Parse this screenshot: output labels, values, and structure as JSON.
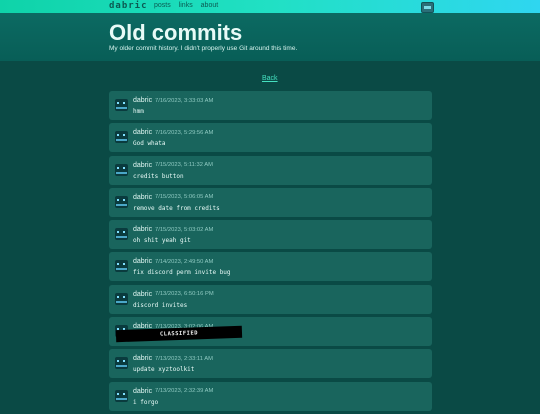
{
  "nav": {
    "brand": "dabric",
    "links": [
      "posts",
      "links",
      "about"
    ]
  },
  "header": {
    "title": "Old commits",
    "subtitle": "My older commit history. I didn't properly use Git around this time."
  },
  "back_label": "Back",
  "commits": [
    {
      "author": "dabric",
      "date": "7/16/2023, 3:33:03 AM",
      "message": "hmm"
    },
    {
      "author": "dabric",
      "date": "7/16/2023, 5:29:56 AM",
      "message": "God whata"
    },
    {
      "author": "dabric",
      "date": "7/15/2023, 5:11:32 AM",
      "message": "credits button"
    },
    {
      "author": "dabric",
      "date": "7/15/2023, 5:06:05 AM",
      "message": "remove date from credits"
    },
    {
      "author": "dabric",
      "date": "7/15/2023, 5:03:02 AM",
      "message": "oh shit yeah git"
    },
    {
      "author": "dabric",
      "date": "7/14/2023, 2:49:50 AM",
      "message": "fix discord perm invite bug"
    },
    {
      "author": "dabric",
      "date": "7/13/2023, 6:50:16 PM",
      "message": "discord invites"
    },
    {
      "author": "dabric",
      "date": "7/13/2023, 3:02:06 AM",
      "message": ""
    },
    {
      "author": "dabric",
      "date": "7/13/2023, 2:33:11 AM",
      "message": "update xyztoolkit"
    },
    {
      "author": "dabric",
      "date": "7/13/2023, 2:32:39 AM",
      "message": "i forgo"
    }
  ],
  "redaction_label": "CLASSIFIED",
  "colors": {
    "accent": "#21e0c4",
    "background": "#0a4a45",
    "card": "#19655d"
  }
}
